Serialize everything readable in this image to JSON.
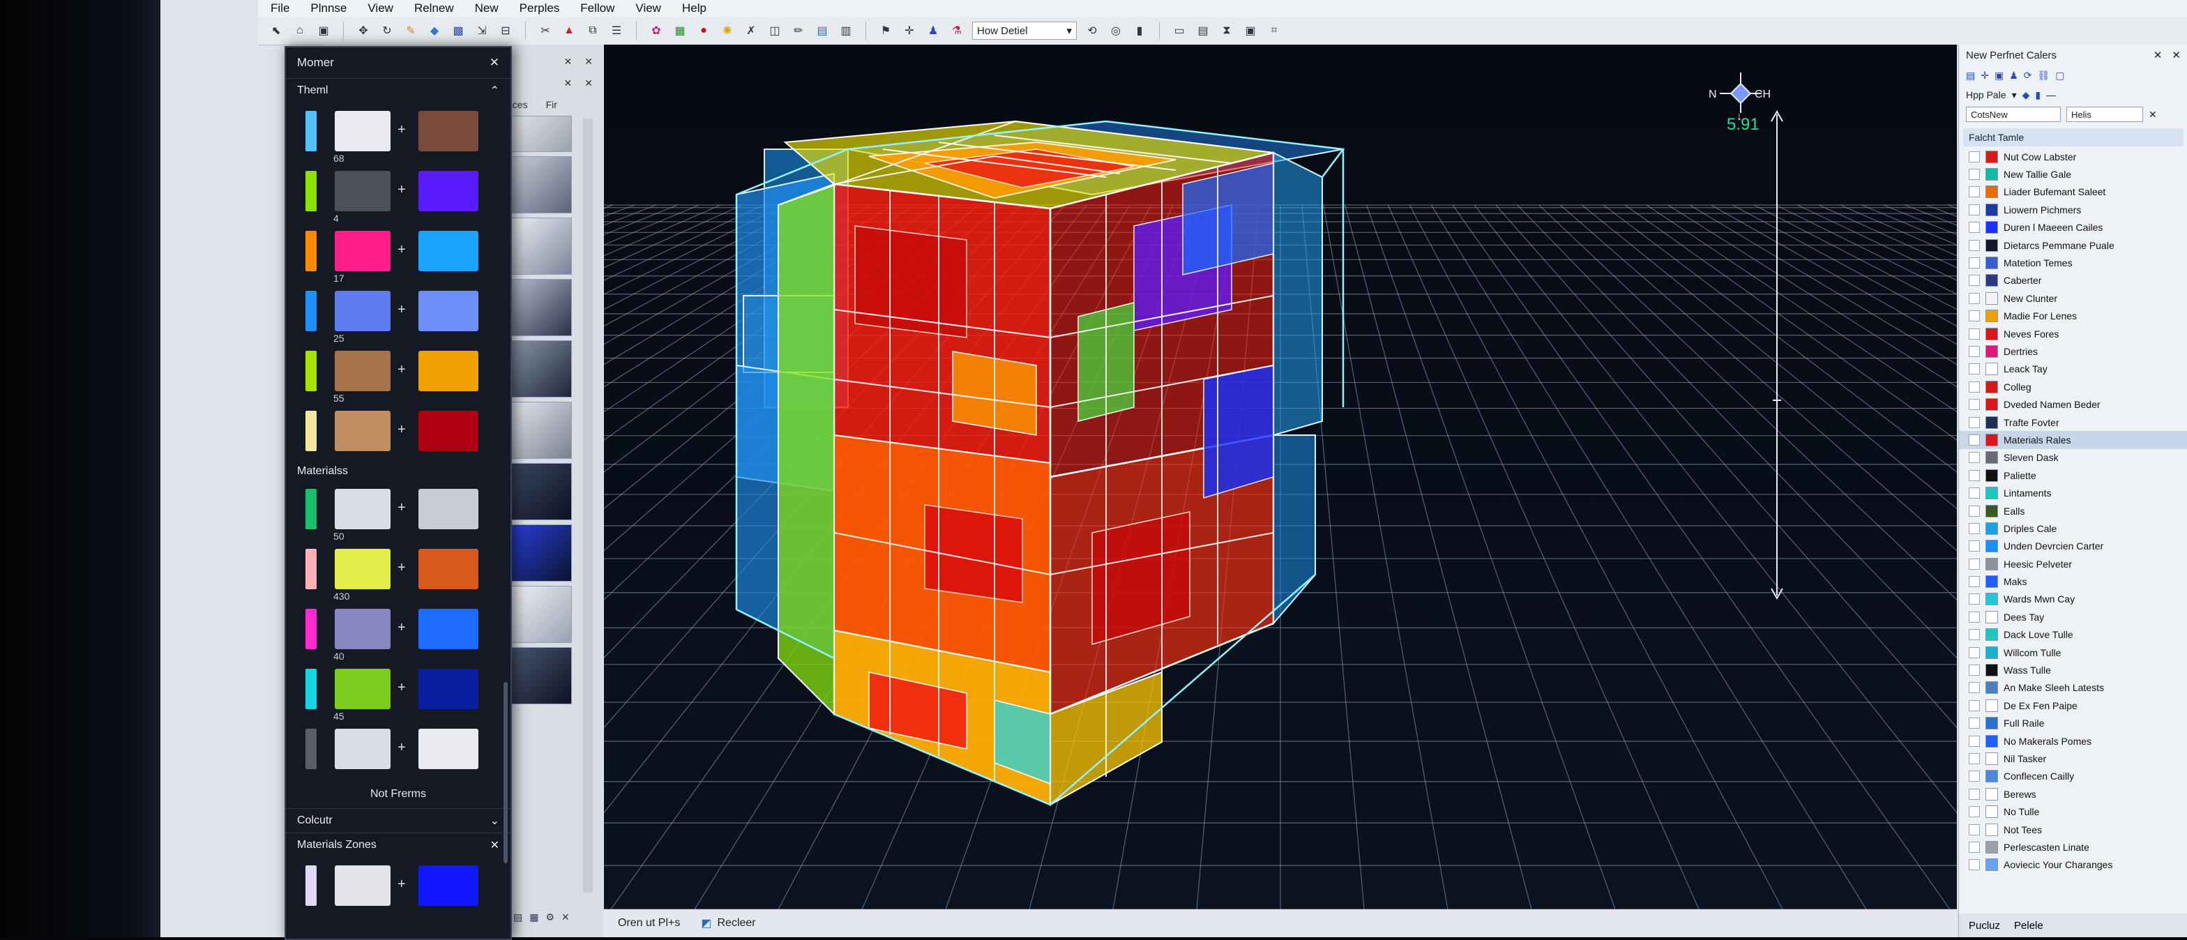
{
  "menu": [
    "File",
    "Plnnse",
    "View",
    "Relnew",
    "New",
    "Perples",
    "Fellow",
    "View",
    "Help"
  ],
  "toolbar": {
    "dropdown_value": "How Detiel"
  },
  "left_panel": {
    "tab_left": "ecces",
    "tab_right": "Fir"
  },
  "float_panel": {
    "title": "Momer",
    "section_theme": "Theml",
    "theme_rows": [
      {
        "strip": "#4fc3f7",
        "c1": "#e8eaf0",
        "c2": "#7a4a3a",
        "num": "68"
      },
      {
        "strip": "#8ee000",
        "c1": "#4c5058",
        "c2": "#5a1cff",
        "num": "4"
      },
      {
        "strip": "#ff8a00",
        "c1": "#ff1e8a",
        "c2": "#1aa3ff",
        "num": "17"
      },
      {
        "strip": "#1e90ff",
        "c1": "#5f7cf0",
        "c2": "#6e8ef8",
        "num": "25"
      },
      {
        "strip": "#a6e300",
        "c1": "#a7744a",
        "c2": "#f0a000",
        "num": "55"
      },
      {
        "strip": "#f2e6a0",
        "c1": "#c38e5f",
        "c2": "#b00010",
        "num": ""
      }
    ],
    "section_materials": "Materialss",
    "material_rows": [
      {
        "strip": "#1bbf6a",
        "c1": "#d9dce4",
        "c2": "#c8ccd4",
        "num": "50"
      },
      {
        "strip": "#ffb0b8",
        "c1": "#e1ee4a",
        "c2": "#d8591a",
        "num": "430"
      },
      {
        "strip": "#ff2ad0",
        "c1": "#8a88c2",
        "c2": "#1e6bff",
        "num": "40"
      },
      {
        "strip": "#12d6e8",
        "c1": "#7ccc1e",
        "c2": "#0b1ea0",
        "num": "45"
      },
      {
        "strip": "#5a5f6a",
        "c1": "#dadce3",
        "c2": "#e9ebf0",
        "num": ""
      }
    ],
    "footer_text": "Not Frerms",
    "section_color": "Colcutr",
    "section_zones": "Materials Zones",
    "zone_row": {
      "strip": "#ded8f0",
      "c1": "#e2e4ea",
      "c2": "#1018ff"
    }
  },
  "right_panel": {
    "header": "New  Perfnet Calers",
    "dropdown1": "Hpp  Pale",
    "field1": "CotsNew",
    "field2": "Helis",
    "section": "Falcht Tamle",
    "items": [
      {
        "label": "Nut Cow Labster",
        "color": "#e01818",
        "sel": false
      },
      {
        "label": "New Tallie Gale",
        "color": "#14b8a6",
        "sel": false
      },
      {
        "label": "Liader Bufemant Saleet",
        "color": "#e86a00",
        "sel": false
      },
      {
        "label": "Liowern Pichmers",
        "color": "#1e3aa0",
        "sel": false
      },
      {
        "label": "Duren l Maeeen Cailes",
        "color": "#1e30ff",
        "sel": false
      },
      {
        "label": "Dietarcs Pemmane Puale",
        "color": "#101827",
        "sel": false
      },
      {
        "label": "Matetion Temes",
        "color": "#3c5bd0",
        "sel": false
      },
      {
        "label": "Caberter",
        "color": "#2a3a80",
        "sel": false
      },
      {
        "label": "New Clunter",
        "color": "#f4f4f4",
        "sel": false
      },
      {
        "label": "Madie For Lenes",
        "color": "#f0a000",
        "sel": false
      },
      {
        "label": "Neves Fores",
        "color": "#d81818",
        "sel": false
      },
      {
        "label": "Dertries",
        "color": "#e0187a",
        "sel": false
      },
      {
        "label": "Leack Tay",
        "color": "#ffffff",
        "sel": false
      },
      {
        "label": "Colleg",
        "color": "#d81818",
        "sel": false
      },
      {
        "label": "Dveded Namen Beder",
        "color": "#d81818",
        "sel": false
      },
      {
        "label": "Trafte Fovter",
        "color": "#203050",
        "sel": false
      },
      {
        "label": "Materials Rales",
        "color": "#d81818",
        "sel": true
      },
      {
        "label": "Sleven Dask",
        "color": "#6a6a72",
        "sel": false
      },
      {
        "label": "Paliette",
        "color": "#101010",
        "sel": false
      },
      {
        "label": "Lintaments",
        "color": "#18c8c0",
        "sel": false
      },
      {
        "label": "Ealls",
        "color": "#3a5a20",
        "sel": false
      },
      {
        "label": "Driples Cale",
        "color": "#18a0e0",
        "sel": false
      },
      {
        "label": "Unden Devrcien Carter",
        "color": "#1890ff",
        "sel": false
      },
      {
        "label": "Heesic Pelveter",
        "color": "#909098",
        "sel": false
      },
      {
        "label": "Maks",
        "color": "#1e60ff",
        "sel": false
      },
      {
        "label": "Wards Mwn Cay",
        "color": "#1ec8d8",
        "sel": false
      },
      {
        "label": "Dees Tay",
        "color": "#ffffff",
        "sel": false
      },
      {
        "label": "Dack Love Tulle",
        "color": "#1ec8c0",
        "sel": false
      },
      {
        "label": "Willcom Tulle",
        "color": "#1ab0d0",
        "sel": false
      },
      {
        "label": "Wass Tulle",
        "color": "#101010",
        "sel": false
      },
      {
        "label": "An Make Sleeh Latests",
        "color": "#4a80c0",
        "sel": false
      },
      {
        "label": "De Ex Fen Paipe",
        "color": "#ffffff",
        "sel": false
      },
      {
        "label": "Full Raile",
        "color": "#2a70d0",
        "sel": false
      },
      {
        "label": "No Makerals Pomes",
        "color": "#1e60ff",
        "sel": false
      },
      {
        "label": "Nil Tasker",
        "color": "#ffffff",
        "sel": false
      },
      {
        "label": "Conflecen Cailly",
        "color": "#4a8ae0",
        "sel": false
      },
      {
        "label": "Berews",
        "color": "#ffffff",
        "sel": false
      },
      {
        "label": "No Tulle",
        "color": "#ffffff",
        "sel": false
      },
      {
        "label": "Not Tees",
        "color": "#ffffff",
        "sel": false
      },
      {
        "label": "Perlescasten Linate",
        "color": "#9aa0aa",
        "sel": false
      },
      {
        "label": "Aoviecic Your Charanges",
        "color": "#6aa0f0",
        "sel": false
      }
    ],
    "bottom": [
      "Pucluz",
      "Pelele"
    ]
  },
  "viewport": {
    "compass_n": "N",
    "compass_e": "CH",
    "readout": "5.91",
    "status": [
      "Oren ut Pl+s",
      "Recleer"
    ]
  }
}
